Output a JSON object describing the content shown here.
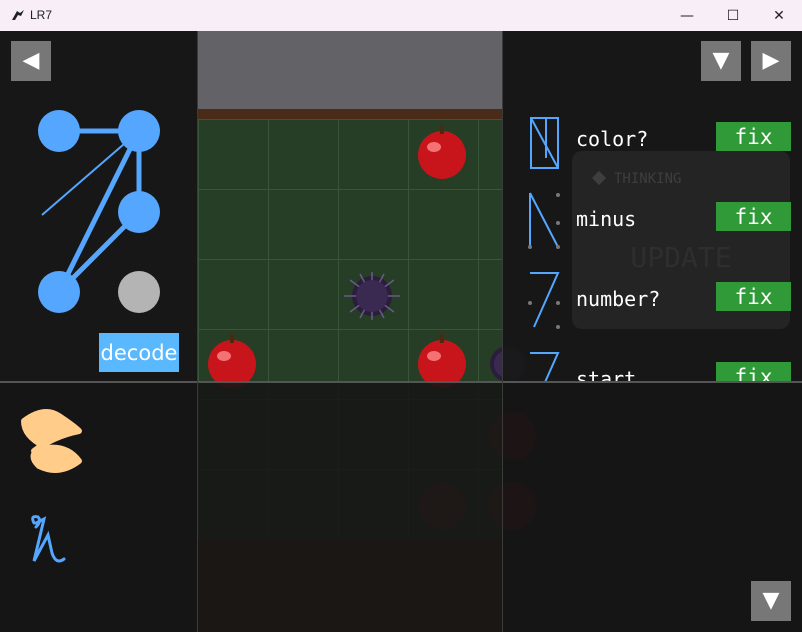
{
  "window": {
    "title": "LR7",
    "minimize_glyph": "—",
    "maximize_glyph": "☐",
    "close_glyph": "✕"
  },
  "nav": {
    "back_glyph": "◀",
    "down_glyph": "▼",
    "forward_glyph": "▶",
    "bottom_down_glyph": "▼"
  },
  "decoder": {
    "decode_label": "decode"
  },
  "rules": [
    {
      "label": "color?",
      "fix_label": "fix"
    },
    {
      "label": "minus",
      "fix_label": "fix"
    },
    {
      "label": "number?",
      "fix_label": "fix"
    },
    {
      "label": "start",
      "fix_label": "fix"
    }
  ],
  "thinking": {
    "label": "THINKING",
    "update_label": "UPDATE"
  },
  "colors": {
    "accent_blue": "#5ab8ff",
    "fix_green": "#2f9a37",
    "node_blue": "#55a6ff",
    "node_gray": "#b4b4b4",
    "scribble": "#ffcc8a"
  },
  "icons": [
    "back-arrow-icon",
    "down-arrow-icon",
    "forward-arrow-icon",
    "apple-icon",
    "sea-urchin-icon",
    "scribble-icon",
    "glyph-icon"
  ]
}
